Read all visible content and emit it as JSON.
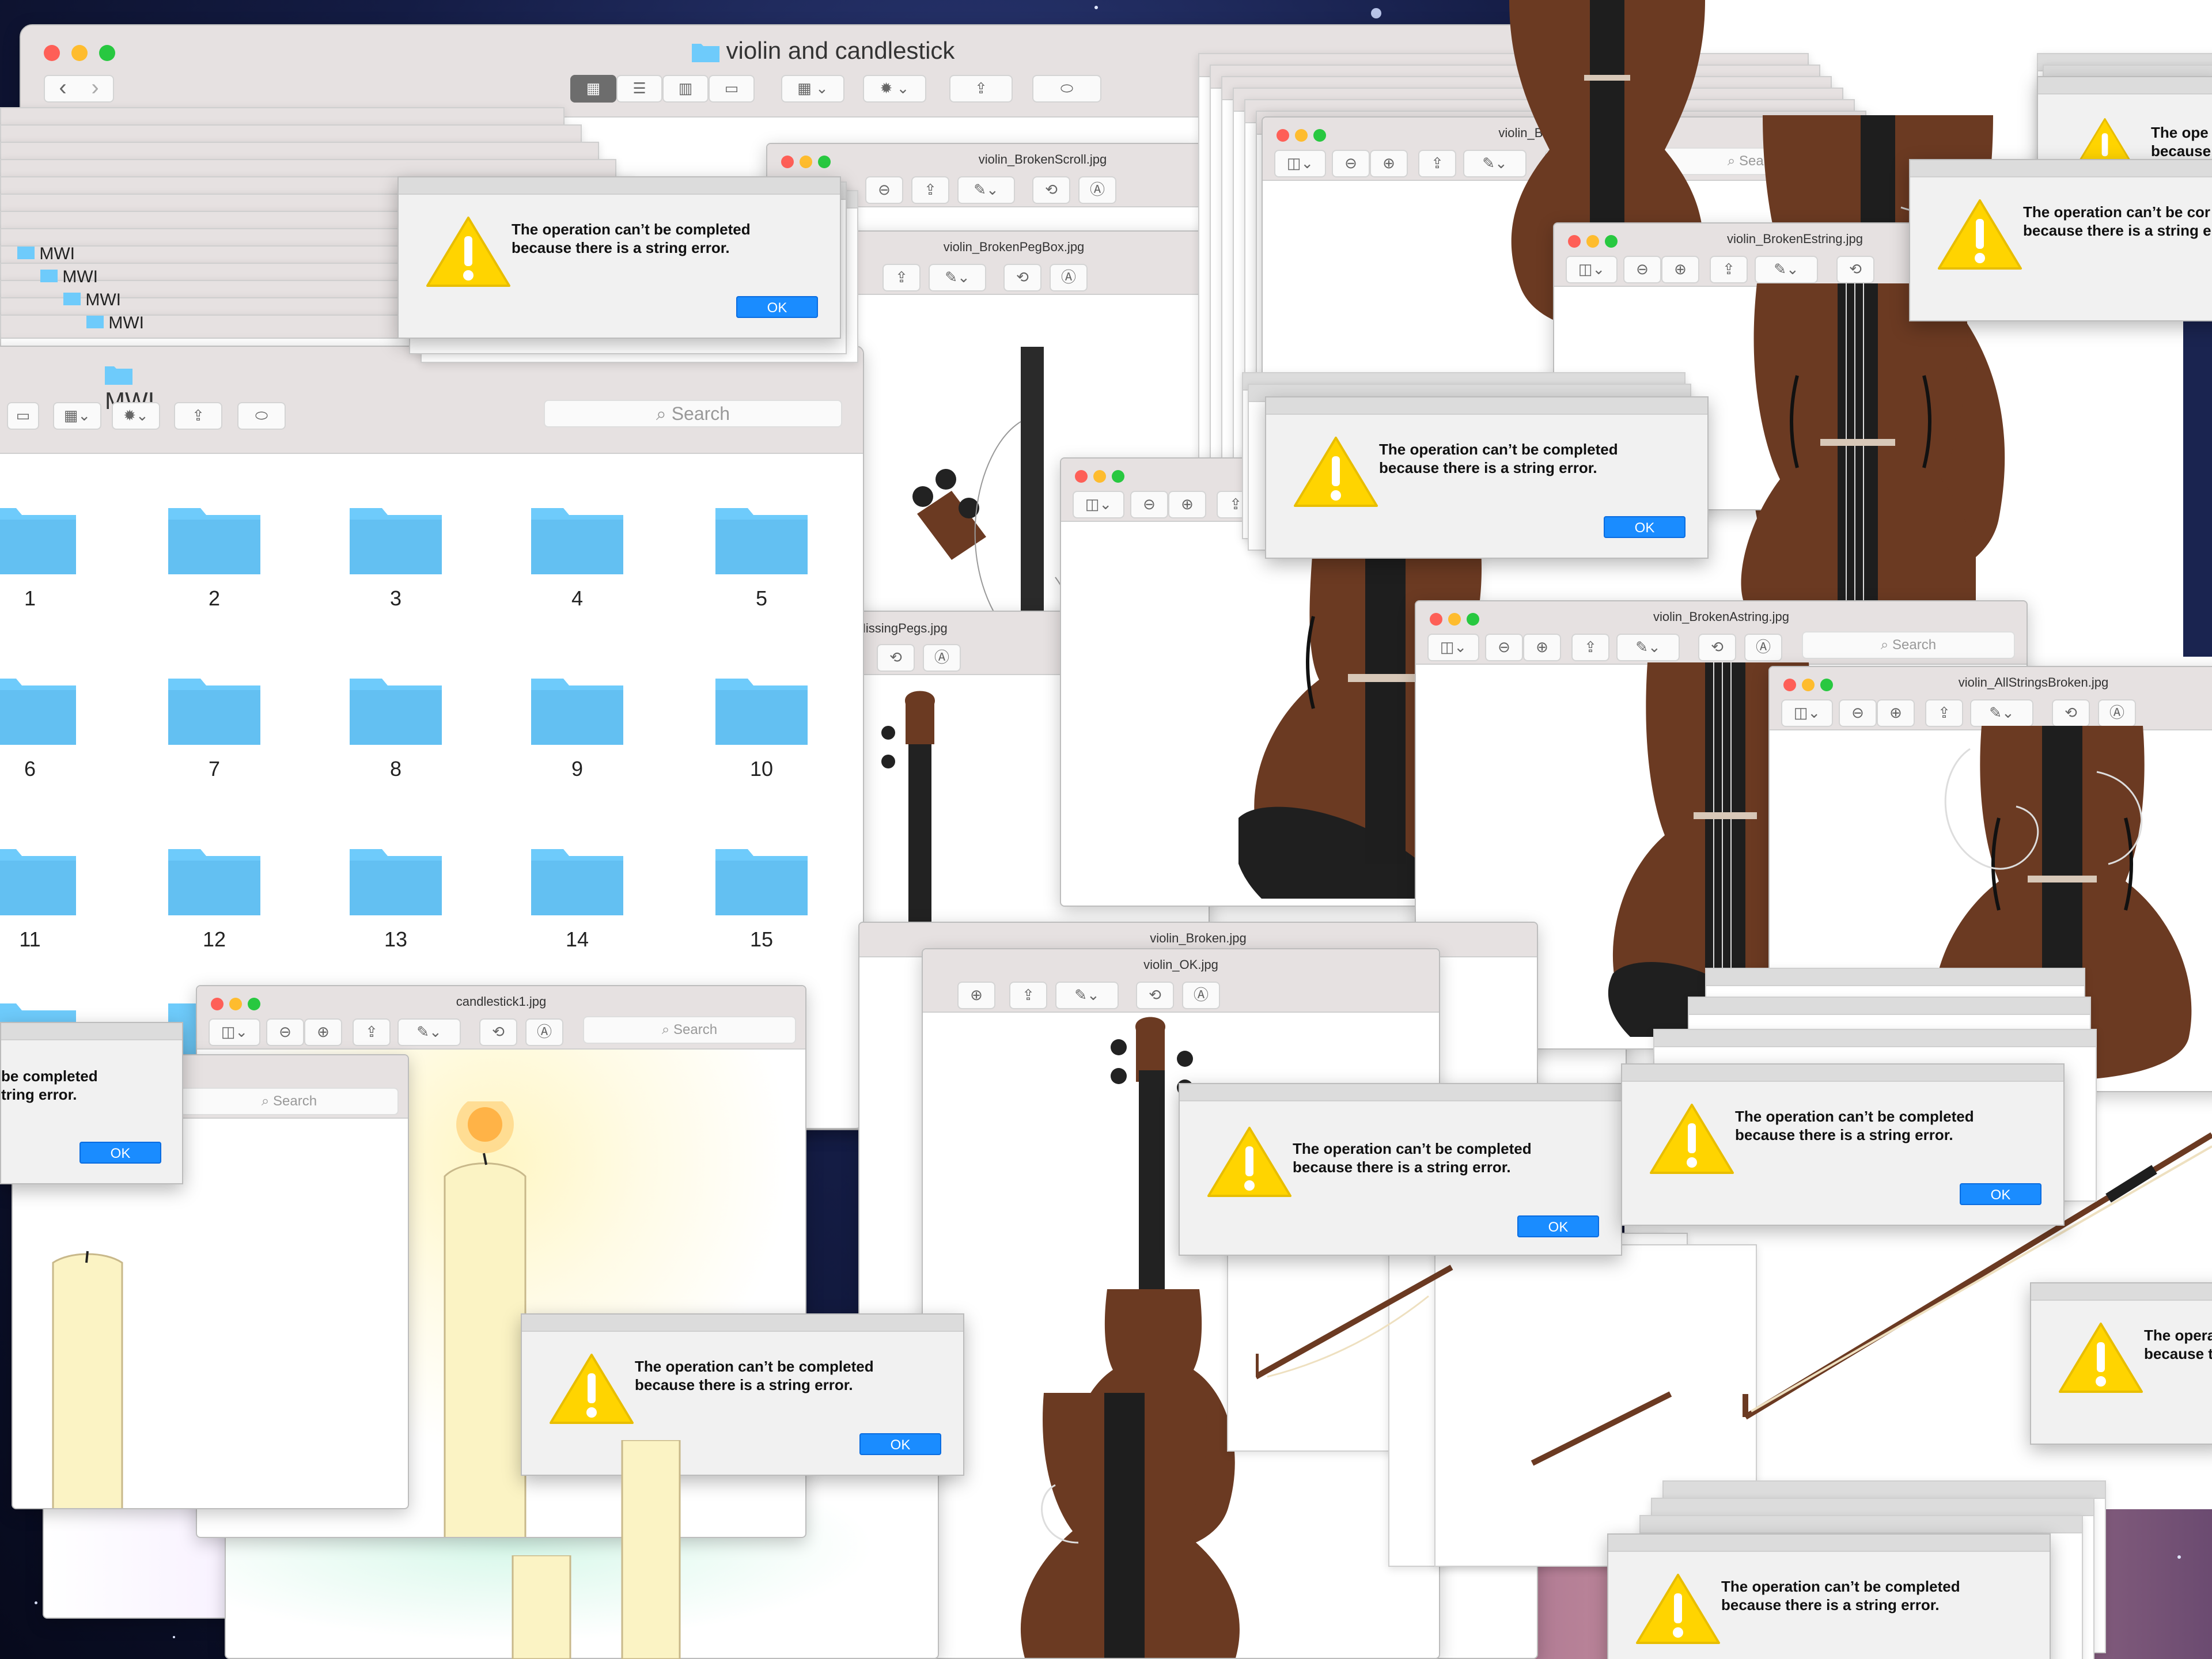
{
  "finder_main": {
    "title": "violin and candlestick",
    "traffic_lights": [
      "close",
      "minimize",
      "zoom"
    ],
    "nav_back": "‹",
    "nav_forward": "›",
    "toolbar_icons": [
      "grid-view-icon",
      "list-view-icon",
      "column-view-icon",
      "gallery-view-icon",
      "group-icon",
      "gear-icon",
      "share-icon",
      "tag-icon"
    ]
  },
  "finder_mwi": {
    "title": "MWI",
    "search_placeholder": "Search",
    "folders": [
      "1",
      "2",
      "3",
      "4",
      "5",
      "6",
      "7",
      "8",
      "9",
      "10",
      "11",
      "12",
      "13",
      "14",
      "15"
    ]
  },
  "cascade_titles": [
    "MWI",
    "MWI",
    "MWI",
    "MWI",
    "MWI",
    "MWI"
  ],
  "preview_windows": {
    "broken_scroll": "violin_BrokenScroll.jpg",
    "broken_pegbox": "violin_BrokenPegBox.jpg",
    "missing_pegs": "in_MissingPegs.jpg",
    "broken_dstring": "violin_BrokenDstring.jpg",
    "broken_estring": "violin_BrokenEstring.jpg",
    "broken_astring": "violin_BrokenAstring.jpg",
    "all_strings_broken": "violin_AllStringsBroken.jpg",
    "broken": "violin_Broken.jpg",
    "ok": "violin_OK.jpg",
    "candlestick": "candlestick1.jpg",
    "search_placeholder": "Search"
  },
  "alert": {
    "message_line1": "The operation can’t be completed",
    "message_line2": "because there is a string error.",
    "ok_label": "OK",
    "partial_left_line1": "be completed",
    "partial_left_line2": "tring error.",
    "partial_right_a_line1": "The ope",
    "partial_right_a_line2": "because",
    "partial_right_b_line1": "The operation can’t be cor",
    "partial_right_b_line2": "because there is a string e",
    "partial_right_c_line1": "The opera",
    "partial_right_c_line2": "because t"
  },
  "colors": {
    "finder_toolbar": "#e6e1e1",
    "folder_blue": "#6ecbfb",
    "ok_blue": "#1a8cff",
    "warning_yellow": "#ffd400",
    "violin_brown": "#6b3a22",
    "fingerboard": "#222222",
    "candle": "#fbf3c4"
  }
}
